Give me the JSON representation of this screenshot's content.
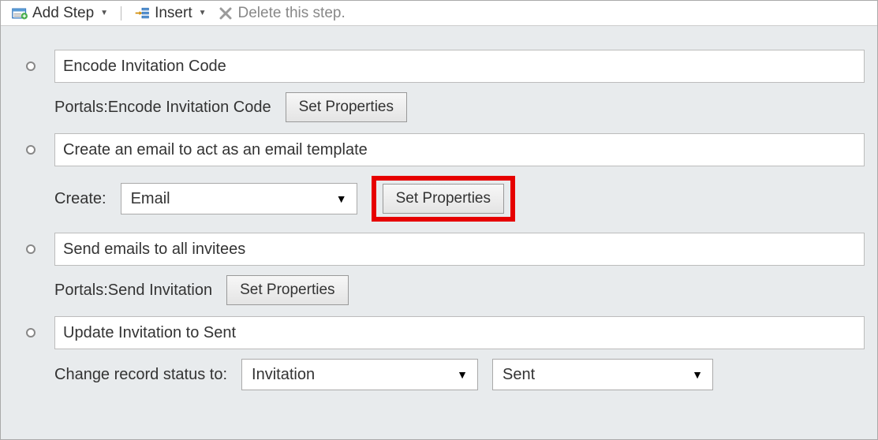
{
  "toolbar": {
    "add_step": "Add Step",
    "insert": "Insert",
    "delete": "Delete this step."
  },
  "steps": {
    "s1": {
      "title": "Encode Invitation Code",
      "detail_label": "Portals:Encode Invitation Code",
      "set_properties": "Set Properties"
    },
    "s2": {
      "title": "Create an email to act as an email template",
      "create_label": "Create:",
      "create_value": "Email",
      "set_properties": "Set Properties"
    },
    "s3": {
      "title": "Send emails to all invitees",
      "detail_label": "Portals:Send Invitation",
      "set_properties": "Set Properties"
    },
    "s4": {
      "title": "Update Invitation to Sent",
      "change_label": "Change record status to:",
      "entity_value": "Invitation",
      "status_value": "Sent"
    }
  }
}
